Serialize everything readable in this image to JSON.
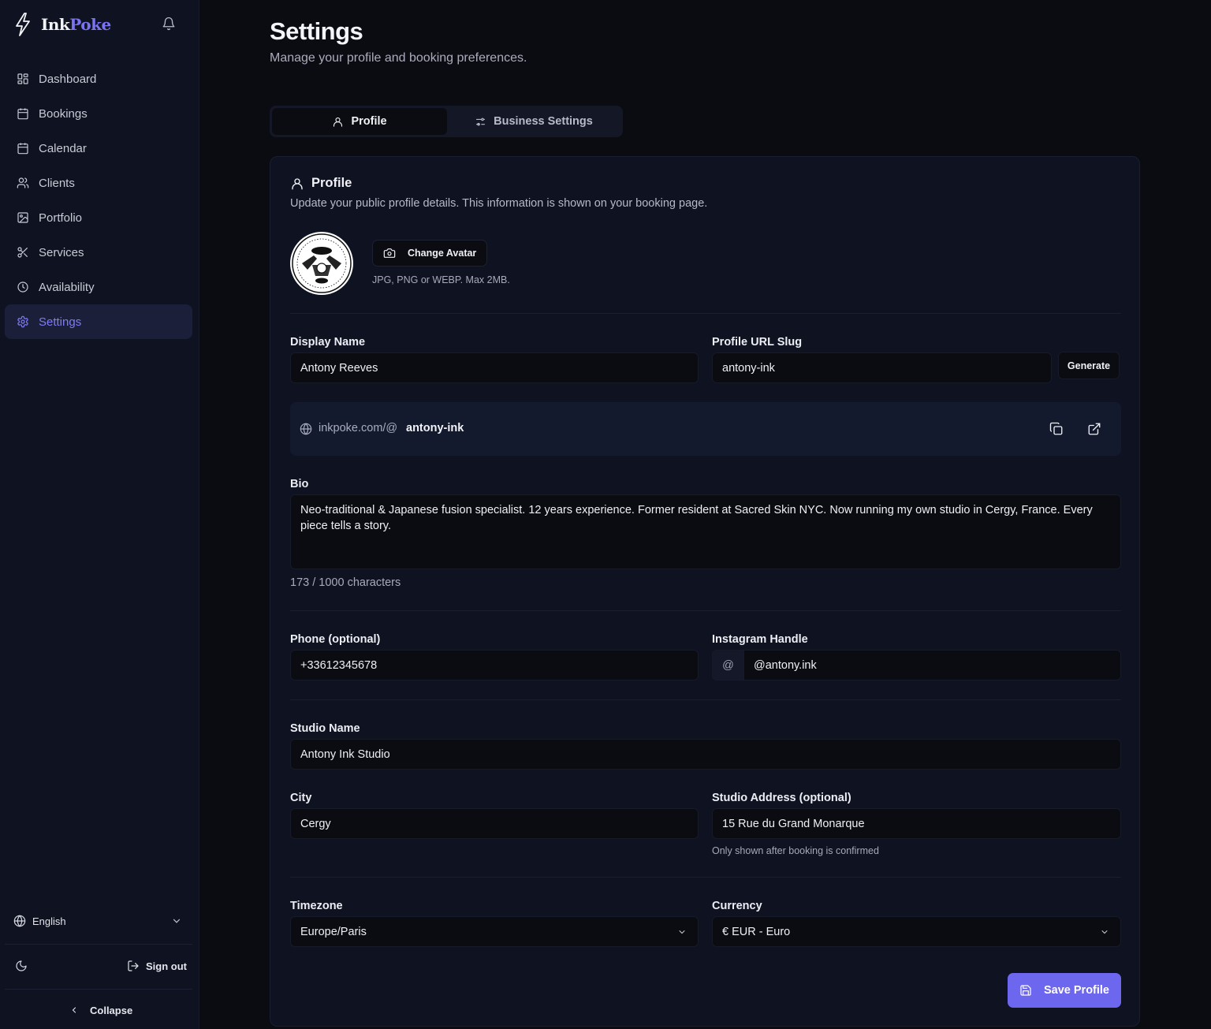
{
  "brand": {
    "name_part1": "Ink",
    "name_part2": "Poke"
  },
  "sidebar": {
    "items": [
      {
        "label": "Dashboard",
        "icon": "grid-icon"
      },
      {
        "label": "Bookings",
        "icon": "calendar-grid-icon"
      },
      {
        "label": "Calendar",
        "icon": "calendar-icon"
      },
      {
        "label": "Clients",
        "icon": "users-icon"
      },
      {
        "label": "Portfolio",
        "icon": "image-icon"
      },
      {
        "label": "Services",
        "icon": "scissors-icon"
      },
      {
        "label": "Availability",
        "icon": "clock-icon"
      },
      {
        "label": "Settings",
        "icon": "gear-icon",
        "active": true
      }
    ],
    "language": "English",
    "sign_out": "Sign out",
    "collapse": "Collapse"
  },
  "header": {
    "title": "Settings",
    "subtitle": "Manage your profile and booking preferences."
  },
  "tabs": [
    {
      "label": "Profile",
      "active": true
    },
    {
      "label": "Business Settings",
      "active": false
    }
  ],
  "profile": {
    "title": "Profile",
    "description": "Update your public profile details. This information is shown on your booking page.",
    "avatar_button": "Change Avatar",
    "avatar_hint": "JPG, PNG or WEBP. Max 2MB.",
    "display_name_label": "Display Name",
    "display_name_value": "Antony Reeves",
    "slug_label": "Profile URL Slug",
    "slug_value": "antony-ink",
    "generate_button": "Generate",
    "url_prefix": "inkpoke.com/@",
    "url_slug": "antony-ink",
    "bio_label": "Bio",
    "bio_value": "Neo-traditional & Japanese fusion specialist. 12 years experience. Former resident at Sacred Skin NYC. Now running my own studio in Cergy, France. Every piece tells a story.",
    "bio_count": "173 / 1000 characters",
    "phone_label": "Phone (optional)",
    "phone_value": "+33612345678",
    "instagram_label": "Instagram Handle",
    "instagram_prefix": "@",
    "instagram_value": "@antony.ink",
    "studio_name_label": "Studio Name",
    "studio_name_value": "Antony Ink Studio",
    "city_label": "City",
    "city_value": "Cergy",
    "address_label": "Studio Address (optional)",
    "address_value": "15 Rue du Grand Monarque",
    "address_hint": "Only shown after booking is confirmed",
    "timezone_label": "Timezone",
    "timezone_value": "Europe/Paris",
    "currency_label": "Currency",
    "currency_value": "€ EUR - Euro",
    "save_button": "Save Profile"
  },
  "colors": {
    "accent": "#6d66ee",
    "background": "#0b0c12",
    "sidebar": "#0f1220",
    "active_nav": "#1b1f3a"
  }
}
